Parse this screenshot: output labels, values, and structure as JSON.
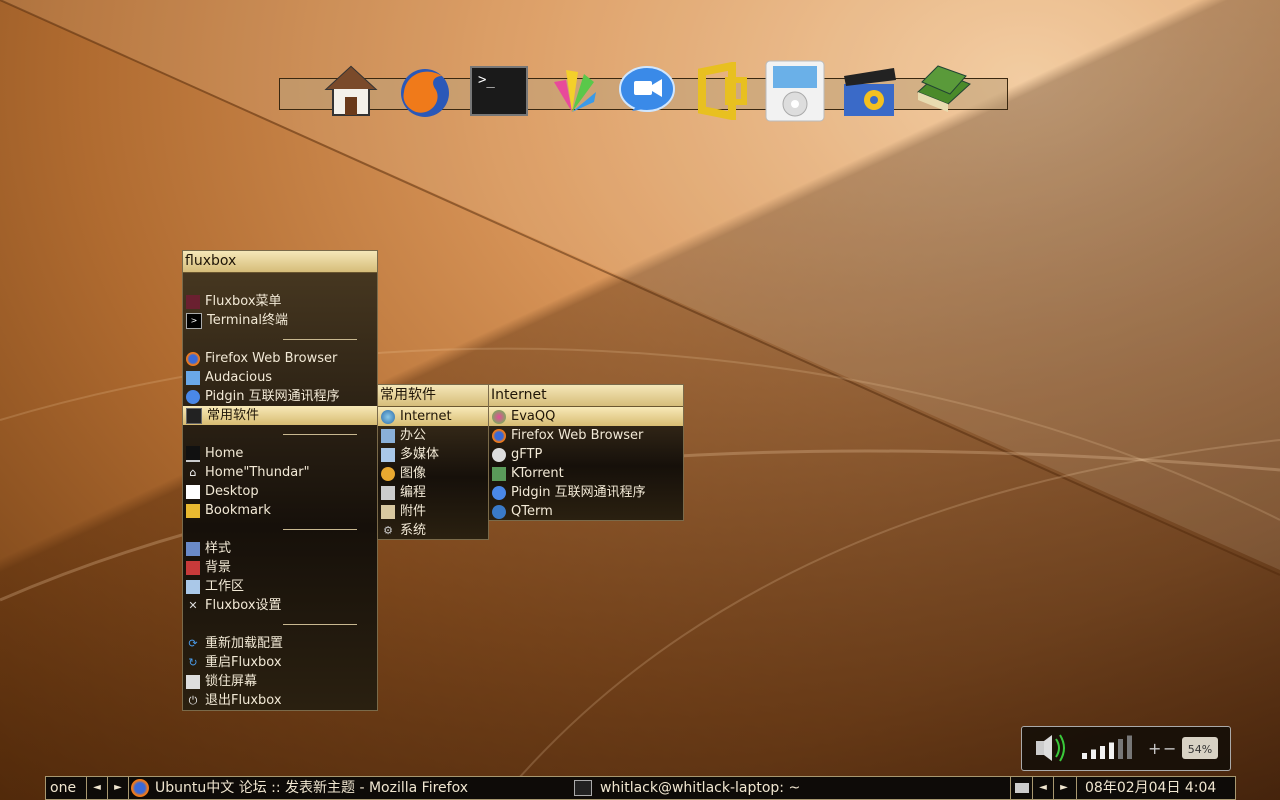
{
  "dock": {
    "icons": [
      "home-icon",
      "firefox-icon",
      "terminal-icon",
      "draw-icon",
      "video-chat-icon",
      "office-icon",
      "ipod-icon",
      "clapperboard-icon",
      "books-icon"
    ]
  },
  "root_menu": {
    "title": "fluxbox",
    "items": [
      {
        "label": "Fluxbox菜单",
        "icon": "fluxbox-icon"
      },
      {
        "label": "Terminal终端",
        "icon": "terminal-icon"
      },
      {
        "label": "Firefox Web Browser",
        "icon": "firefox-icon"
      },
      {
        "label": "Audacious",
        "icon": "audacious-icon"
      },
      {
        "label": "Pidgin 互联网通讯程序",
        "icon": "pidgin-icon"
      },
      {
        "label": "常用软件",
        "icon": "apps-icon"
      },
      {
        "label": "Home",
        "icon": "monitor-icon"
      },
      {
        "label": "Home\"Thundar\"",
        "icon": "home-icon"
      },
      {
        "label": "Desktop",
        "icon": "desktop-icon"
      },
      {
        "label": "Bookmark",
        "icon": "bookmark-icon"
      },
      {
        "label": "样式",
        "icon": "style-icon"
      },
      {
        "label": "背景",
        "icon": "background-icon"
      },
      {
        "label": "工作区",
        "icon": "workspace-icon"
      },
      {
        "label": "Fluxbox设置",
        "icon": "tools-icon"
      },
      {
        "label": "重新加载配置",
        "icon": "reload-icon"
      },
      {
        "label": "重启Fluxbox",
        "icon": "restart-icon"
      },
      {
        "label": "锁住屏幕",
        "icon": "lock-icon"
      },
      {
        "label": "退出Fluxbox",
        "icon": "power-icon"
      }
    ]
  },
  "apps_menu": {
    "title": "常用软件",
    "items": [
      {
        "label": "Internet",
        "icon": "globe-icon"
      },
      {
        "label": "办公",
        "icon": "office-icon"
      },
      {
        "label": "多媒体",
        "icon": "multimedia-icon"
      },
      {
        "label": "图像",
        "icon": "image-icon"
      },
      {
        "label": "编程",
        "icon": "programming-icon"
      },
      {
        "label": "附件",
        "icon": "accessories-icon"
      },
      {
        "label": "系统",
        "icon": "system-icon"
      }
    ]
  },
  "internet_menu": {
    "title": "Internet",
    "items": [
      {
        "label": "EvaQQ",
        "icon": "evaqq-icon"
      },
      {
        "label": "Firefox Web Browser",
        "icon": "firefox-icon"
      },
      {
        "label": "gFTP",
        "icon": "gftp-icon"
      },
      {
        "label": "KTorrent",
        "icon": "ktorrent-icon"
      },
      {
        "label": "Pidgin 互联网通讯程序",
        "icon": "pidgin-icon"
      },
      {
        "label": "QTerm",
        "icon": "qterm-icon"
      }
    ]
  },
  "volume": {
    "percent_label": "54%",
    "level": 0.54
  },
  "taskbar": {
    "workspace": "one",
    "prev": "◄",
    "next": "►",
    "window1": "Ubuntu中文 论坛 :: 发表新主题 - Mozilla Firefox",
    "window2": "whitlack@whitlack-laptop: ~",
    "clock": "08年02月04日  4:04"
  }
}
